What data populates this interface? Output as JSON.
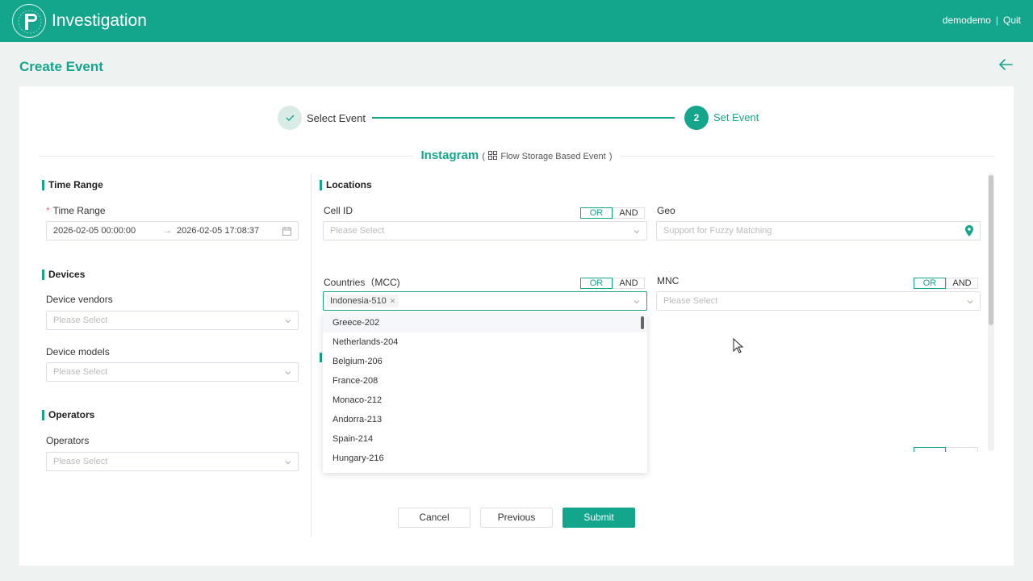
{
  "header": {
    "app_title": "Investigation",
    "user": "demodemo",
    "separator": "|",
    "quit": "Quit",
    "logo_letter": "P"
  },
  "page": {
    "title": "Create Event"
  },
  "steps": {
    "step1_label": "Select Event",
    "step1_icon": "check",
    "step2_number": "2",
    "step2_label": "Set Event"
  },
  "event": {
    "name": "Instagram",
    "subtype_open": "(",
    "subtype": "Flow Storage Based Event",
    "subtype_close": ")"
  },
  "left": {
    "time_section": "Time Range",
    "time_label": "Time Range",
    "time_required": "*",
    "time_start": "2026-02-05 00:00:00",
    "time_arrow": "→",
    "time_end": "2026-02-05 17:08:37",
    "devices_section": "Devices",
    "vendors_label": "Device vendors",
    "vendors_placeholder": "Please Select",
    "models_label": "Device models",
    "models_placeholder": "Please Select",
    "operators_section": "Operators",
    "operators_label": "Operators",
    "operators_placeholder": "Please Select"
  },
  "locations": {
    "section": "Locations",
    "cell_label": "Cell ID",
    "cell_placeholder": "Please Select",
    "geo_label": "Geo",
    "geo_placeholder": "Support for Fuzzy Matching",
    "countries_label": "Countries（MCC)",
    "countries_tag": "Indonesia-510",
    "mnc_label": "MNC",
    "mnc_placeholder": "Please Select",
    "or": "OR",
    "and": "AND"
  },
  "dropdown": {
    "options": [
      "Greece-202",
      "Netherlands-204",
      "Belgium-206",
      "France-208",
      "Monaco-212",
      "Andorra-213",
      "Spain-214",
      "Hungary-216"
    ]
  },
  "buttons": {
    "cancel": "Cancel",
    "previous": "Previous",
    "submit": "Submit"
  },
  "colors": {
    "brand": "#14a58d",
    "background": "#eef3f1",
    "required": "#f56c6c"
  }
}
